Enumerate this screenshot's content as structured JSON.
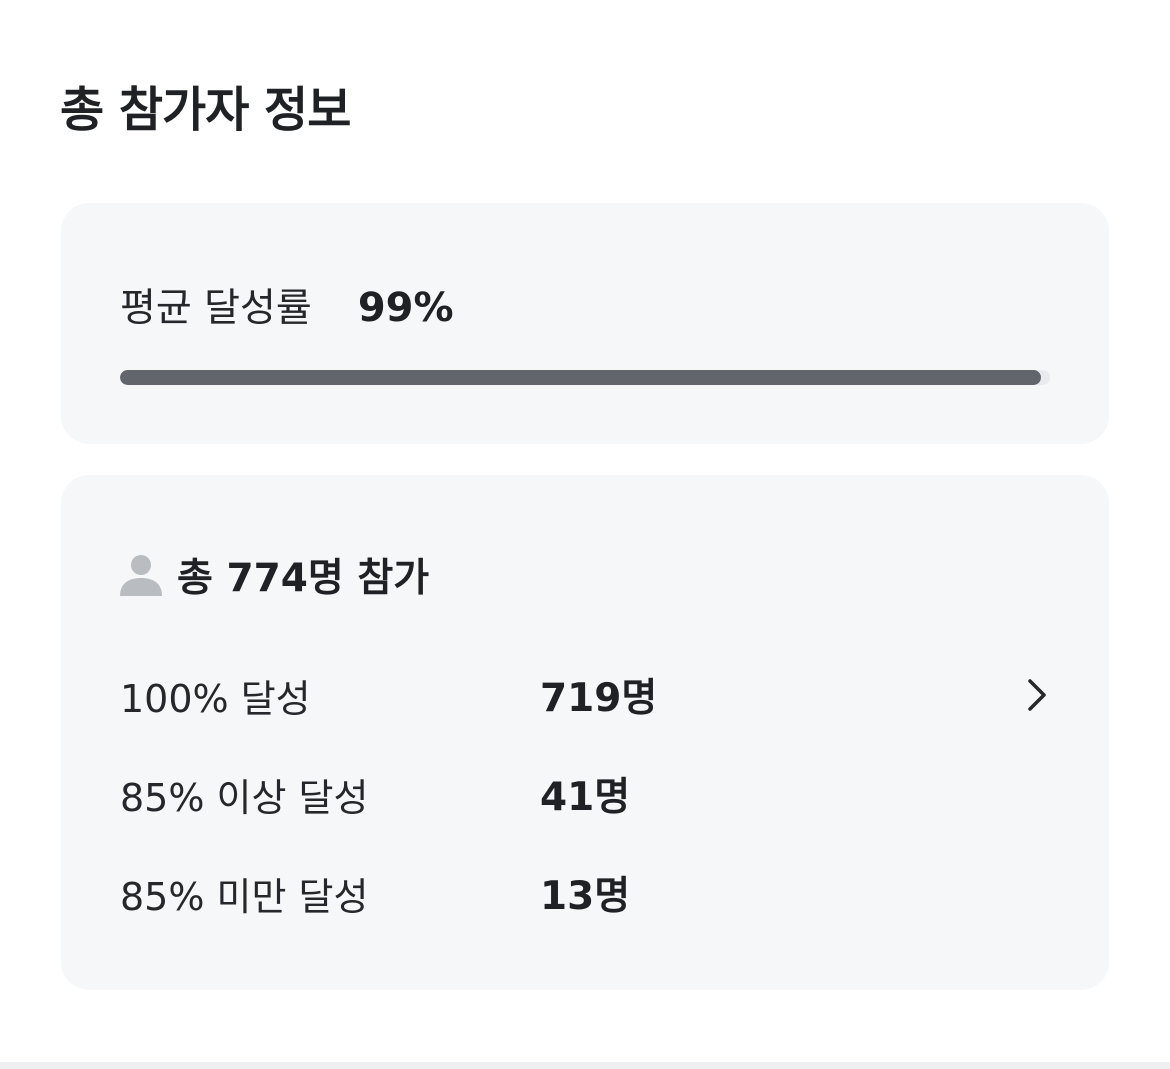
{
  "section": {
    "title": "총 참가자 정보"
  },
  "average": {
    "label": "평균 달성률",
    "value": "99%",
    "progress_fraction": 0.99
  },
  "participants": {
    "total_text": "총 774명 참가",
    "icon": "person-icon",
    "rows": [
      {
        "label": "100% 달성",
        "value": "719명",
        "has_chevron": true
      },
      {
        "label": "85% 이상 달성",
        "value": "41명",
        "has_chevron": false
      },
      {
        "label": "85% 미만 달성",
        "value": "13명",
        "has_chevron": false
      }
    ]
  },
  "colors": {
    "card_background": "#f6f7f9",
    "progress_fill": "#62656c",
    "progress_track": "#e9eaed",
    "icon_gray": "#b9bcc1"
  }
}
